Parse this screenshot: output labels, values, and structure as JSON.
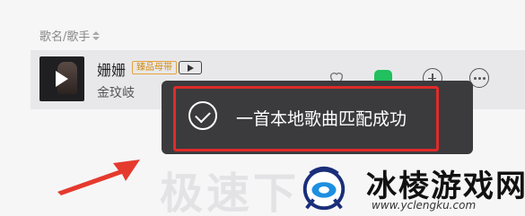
{
  "list_header": {
    "song_artist_label": "歌名/歌手"
  },
  "song": {
    "title": "姗姗",
    "quality_badge": "臻品母带",
    "artist": "金玟岐"
  },
  "background_heading": "极速下",
  "toast": {
    "message": "一首本地歌曲匹配成功"
  },
  "watermark": {
    "name": "冰棱游戏网",
    "url": "www.yclengku.com"
  },
  "colors": {
    "accent_green": "#22c05e",
    "highlight_red": "#e02a2a",
    "badge_gold": "#d38b14",
    "toast_bg": "#3b3b3d"
  }
}
